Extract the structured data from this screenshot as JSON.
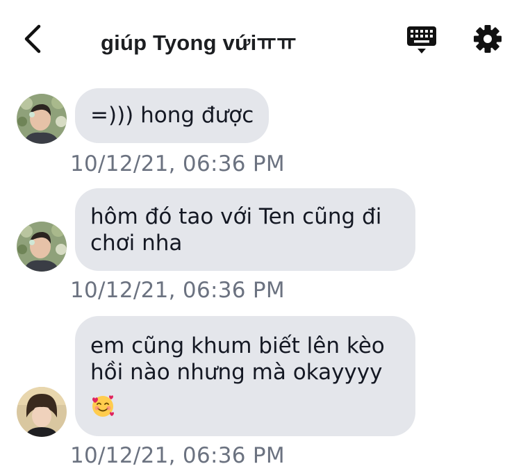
{
  "header": {
    "title": "giúp Tyong vứiㅠㅠ",
    "back_icon": "chevron-left-icon",
    "keyboard_icon": "keyboard-icon",
    "settings_icon": "gear-icon"
  },
  "messages": [
    {
      "lines": [
        "=))) hong được"
      ],
      "timestamp": "10/12/21, 06:36 PM"
    },
    {
      "lines": [
        "hôm đó tao với Ten cũng đi",
        "chơi nha"
      ],
      "timestamp": "10/12/21, 06:36 PM"
    },
    {
      "lines": [
        "em cũng khum biết lên kèo",
        "hồi nào nhưng mà okayyyy"
      ],
      "emoji": "smiling-face-with-hearts-icon",
      "timestamp": "10/12/21, 06:36 PM"
    }
  ],
  "colors": {
    "bubble": "#e4e6eb",
    "timestamp": "#6b7280",
    "text": "#141823"
  }
}
